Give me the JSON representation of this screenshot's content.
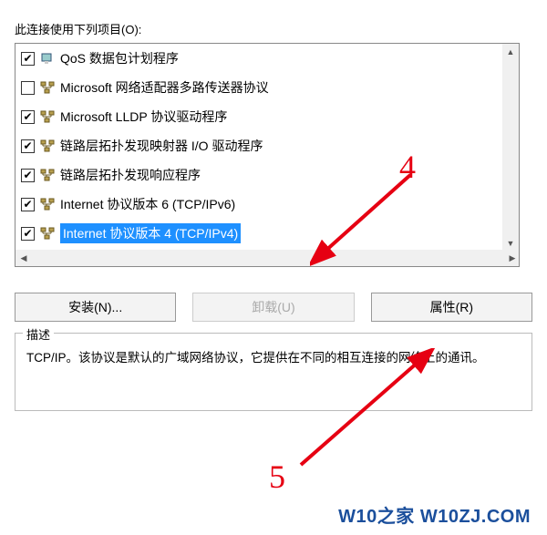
{
  "section_label": "此连接使用下列项目(O):",
  "list_items": [
    {
      "checked": true,
      "icon": "qos",
      "label": "QoS 数据包计划程序",
      "selected": false
    },
    {
      "checked": false,
      "icon": "net",
      "label": "Microsoft 网络适配器多路传送器协议",
      "selected": false
    },
    {
      "checked": true,
      "icon": "net",
      "label": "Microsoft LLDP 协议驱动程序",
      "selected": false
    },
    {
      "checked": true,
      "icon": "net",
      "label": "链路层拓扑发现映射器 I/O 驱动程序",
      "selected": false
    },
    {
      "checked": true,
      "icon": "net",
      "label": "链路层拓扑发现响应程序",
      "selected": false
    },
    {
      "checked": true,
      "icon": "net",
      "label": "Internet 协议版本 6 (TCP/IPv6)",
      "selected": false
    },
    {
      "checked": true,
      "icon": "net",
      "label": "Internet 协议版本 4 (TCP/IPv4)",
      "selected": true
    }
  ],
  "buttons": {
    "install": "安装(N)...",
    "uninstall": "卸载(U)",
    "properties": "属性(R)"
  },
  "description": {
    "title": "描述",
    "text": "TCP/IP。该协议是默认的广域网络协议，它提供在不同的相互连接的网络上的通讯。"
  },
  "annotations": {
    "num4": "4",
    "num5": "5"
  },
  "footer": "W10之家 W10ZJ.COM",
  "colors": {
    "annotation": "#e60012",
    "selected_bg": "#1e90ff",
    "footer": "#1b4f9c"
  }
}
